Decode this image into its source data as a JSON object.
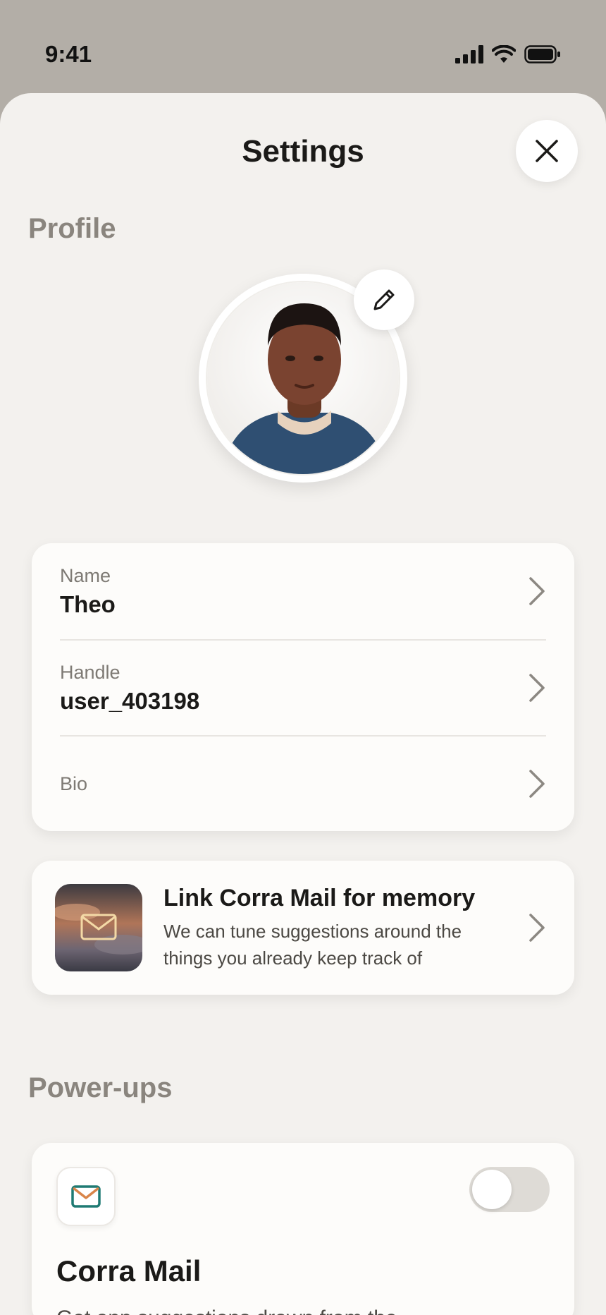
{
  "status_bar": {
    "time": "9:41"
  },
  "header": {
    "title": "Settings"
  },
  "profile": {
    "section_title": "Profile",
    "fields": [
      {
        "label": "Name",
        "value": "Theo"
      },
      {
        "label": "Handle",
        "value": "user_403198"
      },
      {
        "label": "Bio",
        "value": ""
      }
    ]
  },
  "link_card": {
    "title": "Link Corra Mail for memory",
    "description": "We can tune suggestions around the things you already keep track of"
  },
  "powerups": {
    "section_title": "Power-ups",
    "items": [
      {
        "name": "Corra Mail",
        "description": "Get app suggestions drawn from the",
        "enabled": false,
        "icon": "mail-icon"
      }
    ]
  },
  "colors": {
    "sheet_bg": "#f3f1ee",
    "backdrop": "#b3aea7",
    "mail_accent": "#1f7a73",
    "mail_flap": "#d9854a"
  }
}
